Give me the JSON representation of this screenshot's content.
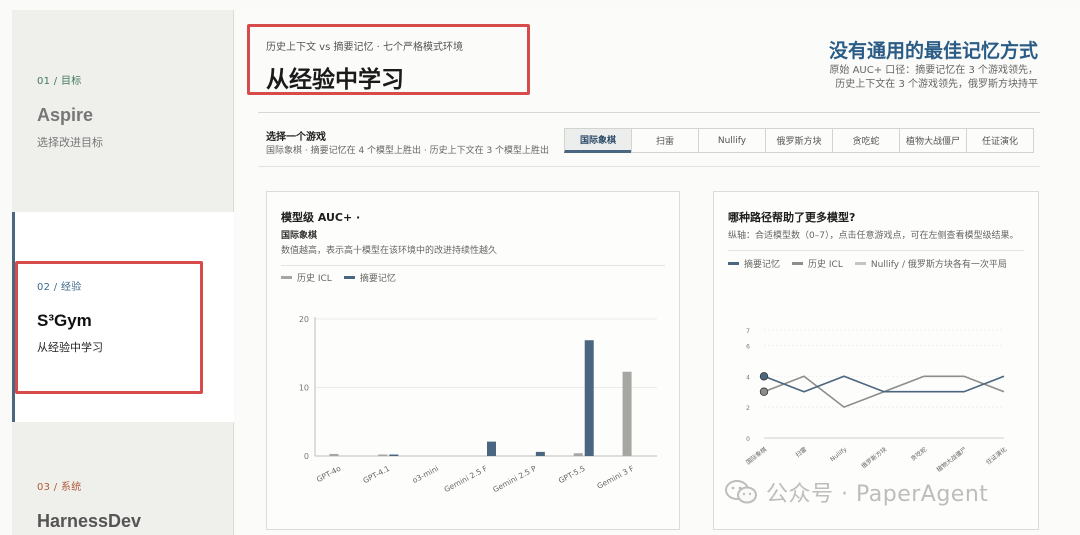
{
  "sidebar": {
    "items": [
      {
        "num": "01 / 目标",
        "title": "Aspire",
        "sub": "选择改进目标"
      },
      {
        "num": "02 / 经验",
        "title": "S³Gym",
        "sub": "从经验中学习"
      },
      {
        "num": "03 / 系统",
        "title": "HarnessDev",
        "sub": ""
      }
    ]
  },
  "header": {
    "subtitle": "历史上下文 vs 摘要记忆 · 七个严格模式环境",
    "title": "从经验中学习",
    "right_title": "没有通用的最佳记忆方式",
    "right_line1": "原始 AUC+ 口径：摘要记忆在 3 个游戏领先，",
    "right_line2": "历史上下文在 3 个游戏领先，俄罗斯方块持平"
  },
  "picker": {
    "label": "选择一个游戏",
    "hint": "国际象棋 · 摘要记忆在 4 个模型上胜出 · 历史上下文在 3 个模型上胜出",
    "tabs": [
      "国际象棋",
      "扫雷",
      "Nullify",
      "俄罗斯方块",
      "贪吃蛇",
      "植物大战僵尸",
      "任证演化"
    ],
    "active": 0
  },
  "card1": {
    "title": "模型级 AUC+ ·",
    "subtitle": "国际象棋",
    "desc": "数值越高，表示高十模型在该环境中的改进持续性越久",
    "legend": [
      {
        "label": "历史 ICL",
        "color": "#a6a6a3"
      },
      {
        "label": "摘要记忆",
        "color": "#4a6680"
      }
    ]
  },
  "card2": {
    "title": "哪种路径帮助了更多模型?",
    "desc": "纵轴：合适模型数（0–7），点击任意游戏点，可在左侧查看模型级结果。",
    "legend": [
      {
        "label": "摘要记忆",
        "color": "#4a6680"
      },
      {
        "label": "历史 ICL",
        "color": "#8d8d8a"
      },
      {
        "label": "Nullify / 俄罗斯方块各有一次平局",
        "color": "#c4c4c1"
      }
    ]
  },
  "chart_data": [
    {
      "type": "bar",
      "categories": [
        "GPT-4o",
        "GPT-4.1",
        "o3-mini",
        "Gemini 2.5 F",
        "Gemini 2.5 P",
        "GPT-5.5",
        "Gemini 3 F"
      ],
      "series": [
        {
          "name": "历史 ICL",
          "color": "#a6a6a3",
          "values": [
            0.3,
            0.2,
            0.0,
            0.0,
            0.0,
            0.4,
            12.3
          ]
        },
        {
          "name": "摘要记忆",
          "color": "#4a6680",
          "values": [
            0.0,
            0.2,
            0.0,
            2.1,
            0.6,
            16.9,
            0.0
          ]
        }
      ],
      "yticks": [
        0,
        10,
        20
      ],
      "ylim": [
        0,
        20
      ]
    },
    {
      "type": "line",
      "categories": [
        "国际象棋",
        "扫雷",
        "Nullify",
        "俄罗斯方块",
        "贪吃蛇",
        "植物大战僵尸",
        "任证演化"
      ],
      "series": [
        {
          "name": "摘要记忆",
          "color": "#4a6680",
          "values": [
            4,
            3,
            4,
            3,
            3,
            3,
            4
          ]
        },
        {
          "name": "历史 ICL",
          "color": "#8d8d8a",
          "values": [
            3,
            4,
            2,
            3,
            4,
            4,
            3
          ]
        }
      ],
      "yticks": [
        0,
        2,
        4,
        6,
        7
      ],
      "ylim": [
        0,
        7
      ]
    }
  ],
  "watermark": {
    "text": "公众号 · PaperAgent"
  }
}
